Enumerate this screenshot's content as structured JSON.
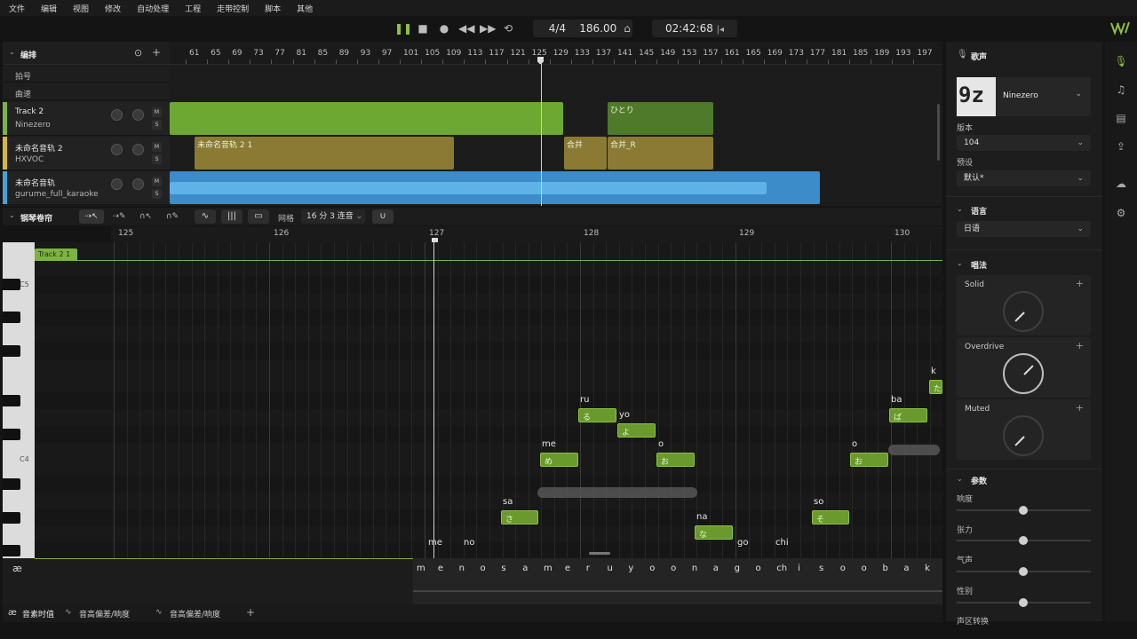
{
  "menu": [
    "文件",
    "编辑",
    "视图",
    "修改",
    "自动处理",
    "工程",
    "走带控制",
    "脚本",
    "其他"
  ],
  "transport": {
    "time_signature": "4/4",
    "tempo": "186.00",
    "time": "02:42:68"
  },
  "arrange": {
    "title": "编排",
    "ruler_ticks": [
      "61",
      "65",
      "69",
      "73",
      "77",
      "81",
      "85",
      "89",
      "93",
      "97",
      "101",
      "105",
      "109",
      "113",
      "117",
      "121",
      "125",
      "129",
      "133",
      "137",
      "141",
      "145",
      "149",
      "153",
      "157",
      "161",
      "165",
      "169",
      "173",
      "177",
      "181",
      "185",
      "189",
      "193",
      "197"
    ],
    "rows": {
      "beat": "拍号",
      "tempo": "曲速"
    },
    "tracks": [
      {
        "name": "Track 2",
        "sub": "Ninezero",
        "color": "#7cb342"
      },
      {
        "name": "未命名音轨 2",
        "sub": "HXVOC",
        "color": "#d4b83b"
      },
      {
        "name": "未命名音轨",
        "sub": "gurume_full_karaoke",
        "color": "#4aa0d6"
      }
    ],
    "mute_label": "M",
    "solo_label": "S",
    "clips": {
      "hitori": "ひとり",
      "mimei": "未命名音轨 2 1",
      "gappei": "合并",
      "gappei_r": "合并_R"
    }
  },
  "piano_roll": {
    "title": "钢琴卷帘",
    "grid_label": "网格",
    "grid_value": "16 分 3 连音",
    "bars": [
      "125",
      "126",
      "127",
      "128",
      "129",
      "130"
    ],
    "clip_tag": "Track 2 1",
    "key_labels": {
      "c5": "C5",
      "c4": "C4"
    },
    "notes": [
      {
        "lyric": "me",
        "kana": ""
      },
      {
        "lyric": "no",
        "kana": ""
      },
      {
        "lyric": "sa",
        "kana": "さ"
      },
      {
        "lyric": "me",
        "kana": "め"
      },
      {
        "lyric": "ru",
        "kana": "る"
      },
      {
        "lyric": "yo",
        "kana": "よ"
      },
      {
        "lyric": "o",
        "kana": "お"
      },
      {
        "lyric": "na",
        "kana": "な"
      },
      {
        "lyric": "go",
        "kana": ""
      },
      {
        "lyric": "chi",
        "kana": ""
      },
      {
        "lyric": "so",
        "kana": "そ"
      },
      {
        "lyric": "o",
        "kana": "お"
      },
      {
        "lyric": "ba",
        "kana": "ば"
      },
      {
        "lyric": "k",
        "kana": "た"
      }
    ]
  },
  "phonemes": [
    "m",
    "e",
    "n",
    "o",
    "s",
    "a",
    "m",
    "e",
    "r",
    "u",
    "y",
    "o",
    "o",
    "n",
    "a",
    "g",
    "o",
    "ch",
    "i",
    "s",
    "o",
    "o",
    "b",
    "a",
    "k"
  ],
  "phoneme_icon": "æ",
  "bottom_tabs": [
    "音素时值",
    "音高偏差/响度",
    "音高偏差/响度"
  ],
  "right_panel": {
    "voice_title": "歌声",
    "singer": "Ninezero",
    "version_label": "版本",
    "version": "104",
    "preset_label": "预设",
    "preset": "默认*",
    "language_title": "语言",
    "language": "日语",
    "style_title": "唱法",
    "styles": [
      "Solid",
      "Overdrive",
      "Muted"
    ],
    "params_title": "参数",
    "params": [
      "响度",
      "张力",
      "气声",
      "性别",
      "声区转换"
    ]
  },
  "colors": {
    "accent": "#8ec044",
    "note": "#6a9a2e",
    "audio": "#4aa0d6"
  }
}
